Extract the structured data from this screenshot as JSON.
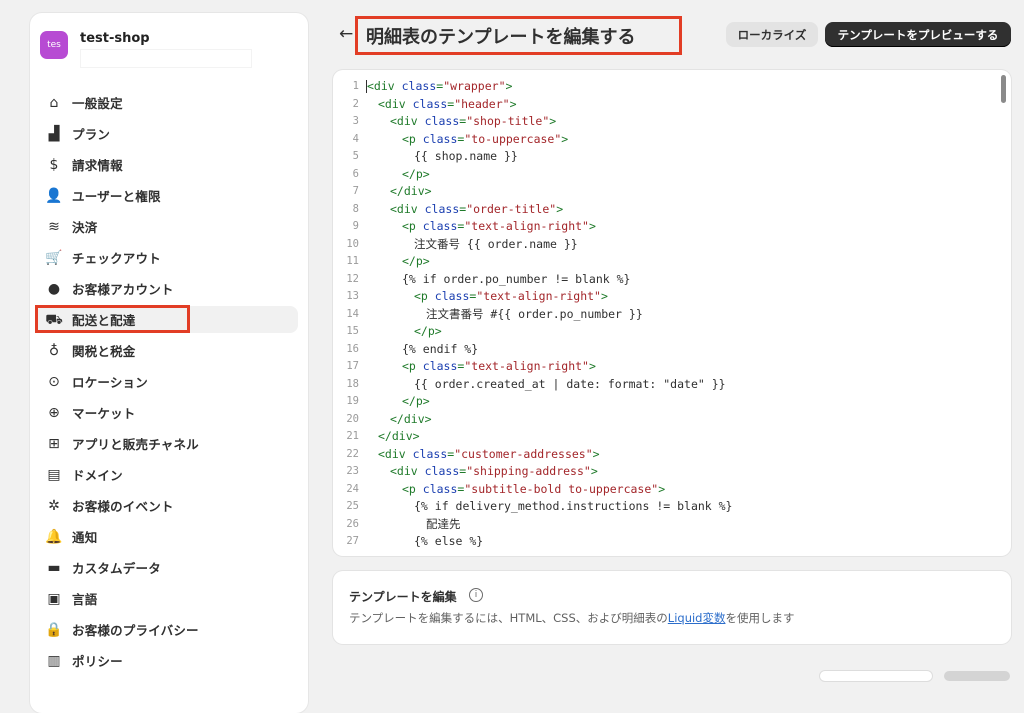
{
  "shop": {
    "avatar_text": "tes",
    "name": "test-shop"
  },
  "sidebar": {
    "items": [
      {
        "label": "一般設定",
        "icon": "store-icon",
        "glyph": "⌂"
      },
      {
        "label": "プラン",
        "icon": "plan-icon",
        "glyph": "▟"
      },
      {
        "label": "請求情報",
        "icon": "billing-icon",
        "glyph": "$"
      },
      {
        "label": "ユーザーと権限",
        "icon": "users-icon",
        "glyph": "👤"
      },
      {
        "label": "決済",
        "icon": "payment-icon",
        "glyph": "≋"
      },
      {
        "label": "チェックアウト",
        "icon": "cart-icon",
        "glyph": "🛒"
      },
      {
        "label": "お客様アカウント",
        "icon": "person-icon",
        "glyph": "●"
      },
      {
        "label": "配送と配達",
        "icon": "truck-icon",
        "glyph": "⛟",
        "active": true
      },
      {
        "label": "関税と税金",
        "icon": "tax-icon",
        "glyph": "♁"
      },
      {
        "label": "ロケーション",
        "icon": "location-icon",
        "glyph": "⊙"
      },
      {
        "label": "マーケット",
        "icon": "globe-icon",
        "glyph": "⊕"
      },
      {
        "label": "アプリと販売チャネル",
        "icon": "apps-icon",
        "glyph": "⊞"
      },
      {
        "label": "ドメイン",
        "icon": "domain-icon",
        "glyph": "▤"
      },
      {
        "label": "お客様のイベント",
        "icon": "events-icon",
        "glyph": "✲"
      },
      {
        "label": "通知",
        "icon": "bell-icon",
        "glyph": "🔔"
      },
      {
        "label": "カスタムデータ",
        "icon": "custom-data-icon",
        "glyph": "▬"
      },
      {
        "label": "言語",
        "icon": "language-icon",
        "glyph": "▣"
      },
      {
        "label": "お客様のプライバシー",
        "icon": "lock-icon",
        "glyph": "🔒"
      },
      {
        "label": "ポリシー",
        "icon": "policy-icon",
        "glyph": "▥"
      }
    ]
  },
  "header": {
    "back_glyph": "←",
    "title": "明細表のテンプレートを編集する",
    "localize_button": "ローカライズ",
    "preview_button": "テンプレートをプレビューする"
  },
  "editor": {
    "lines": [
      {
        "n": "1",
        "indent": 0,
        "parts": [
          [
            "tag",
            "<div "
          ],
          [
            "attr",
            "class"
          ],
          [
            "tag",
            "="
          ],
          [
            "str",
            "\"wrapper\""
          ],
          [
            "tag",
            ">"
          ]
        ]
      },
      {
        "n": "2",
        "indent": 2,
        "parts": [
          [
            "tag",
            "<div "
          ],
          [
            "attr",
            "class"
          ],
          [
            "tag",
            "="
          ],
          [
            "str",
            "\"header\""
          ],
          [
            "tag",
            ">"
          ]
        ]
      },
      {
        "n": "3",
        "indent": 4,
        "parts": [
          [
            "tag",
            "<div "
          ],
          [
            "attr",
            "class"
          ],
          [
            "tag",
            "="
          ],
          [
            "str",
            "\"shop-title\""
          ],
          [
            "tag",
            ">"
          ]
        ]
      },
      {
        "n": "4",
        "indent": 6,
        "parts": [
          [
            "tag",
            "<p "
          ],
          [
            "attr",
            "class"
          ],
          [
            "tag",
            "="
          ],
          [
            "str",
            "\"to-uppercase\""
          ],
          [
            "tag",
            ">"
          ]
        ]
      },
      {
        "n": "5",
        "indent": 8,
        "parts": [
          [
            "txt",
            "{{ shop.name }}"
          ]
        ]
      },
      {
        "n": "6",
        "indent": 6,
        "parts": [
          [
            "tag",
            "</p>"
          ]
        ]
      },
      {
        "n": "7",
        "indent": 4,
        "parts": [
          [
            "tag",
            "</div>"
          ]
        ]
      },
      {
        "n": "8",
        "indent": 4,
        "parts": [
          [
            "tag",
            "<div "
          ],
          [
            "attr",
            "class"
          ],
          [
            "tag",
            "="
          ],
          [
            "str",
            "\"order-title\""
          ],
          [
            "tag",
            ">"
          ]
        ]
      },
      {
        "n": "9",
        "indent": 6,
        "parts": [
          [
            "tag",
            "<p "
          ],
          [
            "attr",
            "class"
          ],
          [
            "tag",
            "="
          ],
          [
            "str",
            "\"text-align-right\""
          ],
          [
            "tag",
            ">"
          ]
        ]
      },
      {
        "n": "10",
        "indent": 8,
        "parts": [
          [
            "txt",
            "注文番号 {{ order.name }}"
          ]
        ]
      },
      {
        "n": "11",
        "indent": 6,
        "parts": [
          [
            "tag",
            "</p>"
          ]
        ]
      },
      {
        "n": "12",
        "indent": 6,
        "parts": [
          [
            "txt",
            "{% if order.po_number != blank %}"
          ]
        ]
      },
      {
        "n": "13",
        "indent": 8,
        "parts": [
          [
            "tag",
            "<p "
          ],
          [
            "attr",
            "class"
          ],
          [
            "tag",
            "="
          ],
          [
            "str",
            "\"text-align-right\""
          ],
          [
            "tag",
            ">"
          ]
        ]
      },
      {
        "n": "14",
        "indent": 10,
        "parts": [
          [
            "txt",
            "注文書番号 #{{ order.po_number }}"
          ]
        ]
      },
      {
        "n": "15",
        "indent": 8,
        "parts": [
          [
            "tag",
            "</p>"
          ]
        ]
      },
      {
        "n": "16",
        "indent": 6,
        "parts": [
          [
            "txt",
            "{% endif %}"
          ]
        ]
      },
      {
        "n": "17",
        "indent": 6,
        "parts": [
          [
            "tag",
            "<p "
          ],
          [
            "attr",
            "class"
          ],
          [
            "tag",
            "="
          ],
          [
            "str",
            "\"text-align-right\""
          ],
          [
            "tag",
            ">"
          ]
        ]
      },
      {
        "n": "18",
        "indent": 8,
        "parts": [
          [
            "txt",
            "{{ order.created_at | date: format: \"date\" }}"
          ]
        ]
      },
      {
        "n": "19",
        "indent": 6,
        "parts": [
          [
            "tag",
            "</p>"
          ]
        ]
      },
      {
        "n": "20",
        "indent": 4,
        "parts": [
          [
            "tag",
            "</div>"
          ]
        ]
      },
      {
        "n": "21",
        "indent": 2,
        "parts": [
          [
            "tag",
            "</div>"
          ]
        ]
      },
      {
        "n": "22",
        "indent": 2,
        "parts": [
          [
            "tag",
            "<div "
          ],
          [
            "attr",
            "class"
          ],
          [
            "tag",
            "="
          ],
          [
            "str",
            "\"customer-addresses\""
          ],
          [
            "tag",
            ">"
          ]
        ]
      },
      {
        "n": "23",
        "indent": 4,
        "parts": [
          [
            "tag",
            "<div "
          ],
          [
            "attr",
            "class"
          ],
          [
            "tag",
            "="
          ],
          [
            "str",
            "\"shipping-address\""
          ],
          [
            "tag",
            ">"
          ]
        ]
      },
      {
        "n": "24",
        "indent": 6,
        "parts": [
          [
            "tag",
            "<p "
          ],
          [
            "attr",
            "class"
          ],
          [
            "tag",
            "="
          ],
          [
            "str",
            "\"subtitle-bold to-uppercase\""
          ],
          [
            "tag",
            ">"
          ]
        ]
      },
      {
        "n": "25",
        "indent": 8,
        "parts": [
          [
            "txt",
            "{% if delivery_method.instructions != blank %}"
          ]
        ]
      },
      {
        "n": "26",
        "indent": 10,
        "parts": [
          [
            "txt",
            "配達先"
          ]
        ]
      },
      {
        "n": "27",
        "indent": 8,
        "parts": [
          [
            "txt",
            "{% else %}"
          ]
        ]
      }
    ]
  },
  "info": {
    "title": "テンプレートを編集",
    "info_glyph": "i",
    "desc_before": "テンプレートを編集するには、HTML、CSS、および明細表の",
    "link": "Liquid変数",
    "desc_after": "を使用します"
  }
}
